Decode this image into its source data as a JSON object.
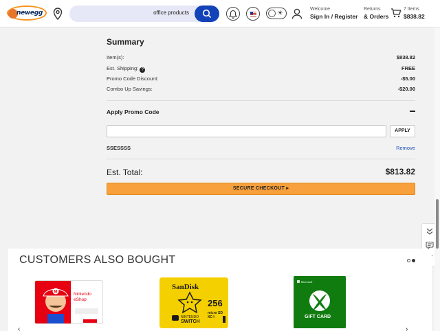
{
  "header": {
    "logo_text": "newegg",
    "search_value": "office products",
    "welcome_label": "Welcome",
    "signin_label": "Sign In / Register",
    "returns_label": "Returns",
    "orders_label": "& Orders",
    "cart_count": "7 Items",
    "cart_total": "$838.82"
  },
  "summary": {
    "title": "Summary",
    "rows": [
      {
        "label": "Item(s):",
        "value": "$838.82"
      },
      {
        "label": "Est. Shipping:",
        "value": "FREE"
      },
      {
        "label": "Promo Code Discount:",
        "value": "-$5.00"
      },
      {
        "label": "Combo Up Savings:",
        "value": "-$20.00"
      }
    ],
    "promo_title": "Apply Promo Code",
    "promo_input_value": "",
    "apply_label": "APPLY",
    "applied_code": "SSESSSS",
    "remove_label": "Remove",
    "est_total_label": "Est. Total:",
    "est_total_value": "$813.82",
    "checkout_label": "SECURE CHECKOUT ▸"
  },
  "also_bought": {
    "title": "CUSTOMERS ALSO BOUGHT",
    "products": [
      {
        "name": "Nintendo eShop gift card",
        "text_line1": "Nintendo",
        "text_line2": "eShop"
      },
      {
        "name": "SanDisk 256 microSDXC Nintendo Switch",
        "brand": "SanDisk",
        "capacity": "256",
        "line_a": "NINTENDO",
        "line_b": "SWITCH",
        "format": "micro SD XC I"
      },
      {
        "name": "Xbox Gift Card",
        "brand": "Microsoft",
        "label": "GIFT CARD"
      }
    ]
  },
  "colors": {
    "accent": "#1342b8",
    "checkout": "#f7a03c",
    "xbox_green": "#107c10",
    "sandisk_yellow": "#f5d000",
    "nintendo_red": "#e60012"
  }
}
